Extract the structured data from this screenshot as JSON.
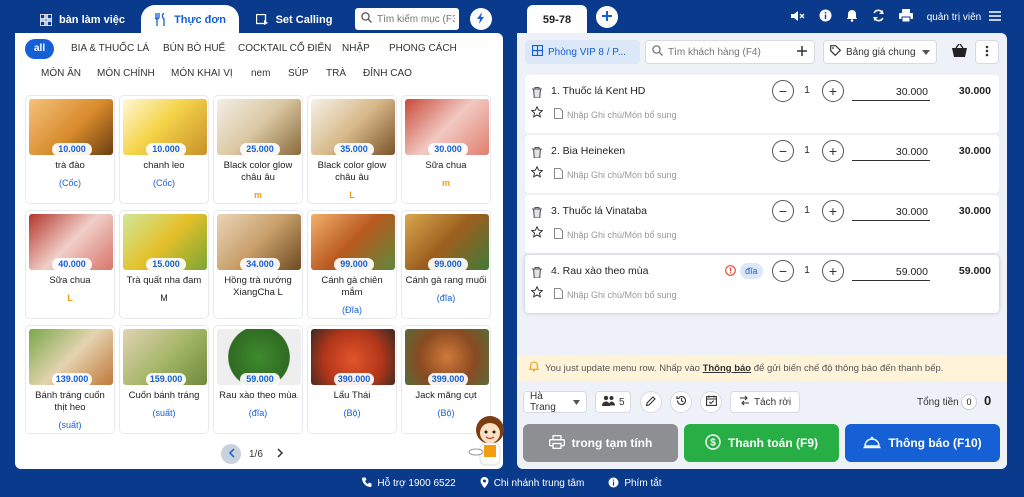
{
  "colors": {
    "brand": "#1560d4",
    "background": "#0a3a8c",
    "success": "#27ae45",
    "muted": "#8d8f93",
    "warning_bg": "#fff4d9"
  },
  "top_tabs": [
    {
      "label": "bàn làm việc",
      "icon": "grid-icon"
    },
    {
      "label": "Thực đơn",
      "icon": "utensils-icon"
    },
    {
      "label": "Set Calling",
      "icon": "calling-icon"
    }
  ],
  "top_search": {
    "placeholder": "Tìm kiếm mục (F3)"
  },
  "categories": [
    "all",
    "BIA & THUỐC LÁ",
    "BÚN BÒ HUẾ",
    "COCKTAIL CỔ ĐIỂN",
    "NHẬP",
    "PHONG CÁCH",
    "MÓN ĂN",
    "MÓN CHÍNH",
    "MÓN KHAI VỊ",
    "nem",
    "SÚP",
    "TRÀ",
    "ĐỈNH CAO"
  ],
  "menu_items": [
    {
      "price": "10.000",
      "name": "trà đào",
      "sub": "(Cốc)",
      "sub_style": "blue"
    },
    {
      "price": "10.000",
      "name": "chanh leo",
      "sub": "(Cốc)",
      "sub_style": "blue"
    },
    {
      "price": "25.000",
      "name": "Black color glow châu âu",
      "sub": "m",
      "sub_style": "orange"
    },
    {
      "price": "35.000",
      "name": "Black color glow châu âu",
      "sub": "L",
      "sub_style": "orange"
    },
    {
      "price": "30.000",
      "name": "Sữa chua",
      "sub": "m",
      "sub_style": "orange"
    },
    {
      "price": "40.000",
      "name": "Sữa chua",
      "sub": "L",
      "sub_style": "orange"
    },
    {
      "price": "15.000",
      "name": "Trà quất nha đam",
      "sub": "M",
      "sub_style": "plain"
    },
    {
      "price": "34.000",
      "name": "Hồng trà nướng XiangCha L",
      "sub": "",
      "sub_style": "plain"
    },
    {
      "price": "99.000",
      "name": "Cánh gà chiên mắm",
      "sub": "(Đĩa)",
      "sub_style": "blue"
    },
    {
      "price": "99.000",
      "name": "Cánh gà rang muối",
      "sub": "(đĩa)",
      "sub_style": "blue"
    },
    {
      "price": "139.000",
      "name": "Bánh tráng cuốn thịt heo",
      "sub": "(suất)",
      "sub_style": "blue"
    },
    {
      "price": "159.000",
      "name": "Cuốn bánh tráng",
      "sub": "(suất)",
      "sub_style": "blue"
    },
    {
      "price": "59.000",
      "name": "Rau xào theo mùa",
      "sub": "(đĩa)",
      "sub_style": "blue"
    },
    {
      "price": "390.000",
      "name": "Lẩu Thái",
      "sub": "(Bộ)",
      "sub_style": "blue"
    },
    {
      "price": "399.000",
      "name": "Jack măng cụt",
      "sub": "(Bộ)",
      "sub_style": "blue"
    }
  ],
  "pager": {
    "text": "1/6"
  },
  "order_tab": {
    "label": "59-78"
  },
  "header_user": {
    "label": "quản trị viên"
  },
  "room": {
    "label": "Phòng VIP 8 / P..."
  },
  "customer_search": {
    "placeholder": "Tìm khách hàng (F4)"
  },
  "price_book": {
    "label": "Bảng giá chung"
  },
  "note_placeholder": "Nhập Ghi chú/Món bổ sung",
  "orders": [
    {
      "name": "1. Thuốc lá Kent HD",
      "qty": "1",
      "unit_price": "30.000",
      "total": "30.000",
      "unit_label": ""
    },
    {
      "name": "2. Bia Heineken",
      "qty": "1",
      "unit_price": "30.000",
      "total": "30.000",
      "unit_label": ""
    },
    {
      "name": "3. Thuốc lá Vinataba",
      "qty": "1",
      "unit_price": "30.000",
      "total": "30.000",
      "unit_label": ""
    },
    {
      "name": "4. Rau xào theo mùa",
      "qty": "1",
      "unit_price": "59.000",
      "total": "59.000",
      "unit_label": "đĩa"
    }
  ],
  "notice": {
    "text_before": "You just update menu row. Nhấp vào ",
    "link": "Thông báo",
    "text_after": " để gửi biến chế độ thông báo đến thanh bếp."
  },
  "bottom": {
    "staff": "Hà Trang",
    "guests": "5",
    "split": "Tách rời",
    "total_label": "Tổng tiền",
    "item_count": "0",
    "total_value": "0"
  },
  "actions": {
    "print": "trong tạm tính",
    "pay": "Thanh toán (F9)",
    "notify": "Thông báo (F10)"
  },
  "footer": {
    "support": "Hỗ trợ 1900 6522",
    "branch": "Chi nhánh trung tâm",
    "shortcuts": "Phím tắt"
  }
}
